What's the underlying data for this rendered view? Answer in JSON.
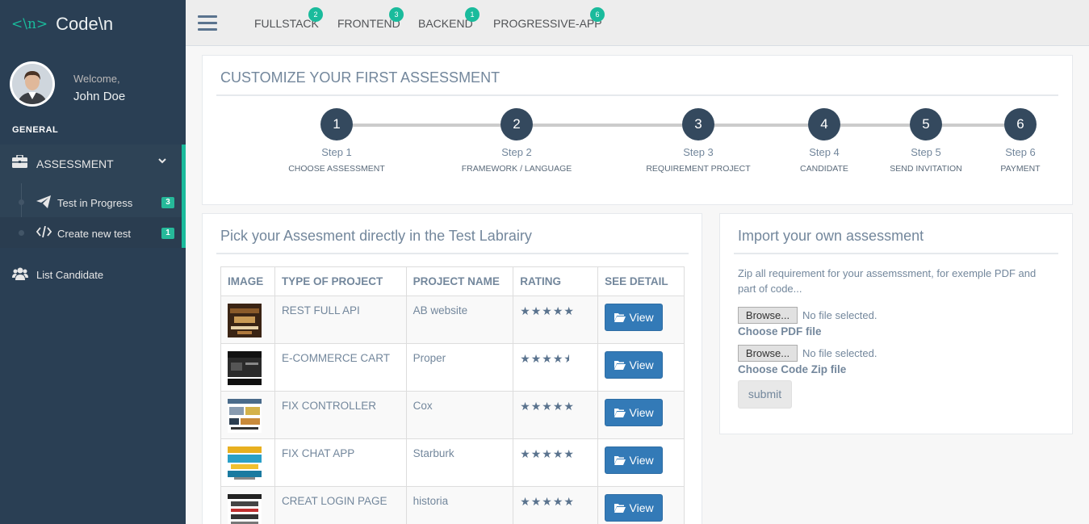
{
  "brand": {
    "logo": "<\\n>",
    "name": "Code\\n"
  },
  "profile": {
    "welcome": "Welcome,",
    "name": "John Doe"
  },
  "sidebar": {
    "section": "GENERAL",
    "assessment_label": "ASSESSMENT",
    "subitems": [
      {
        "label": "Test in Progress",
        "badge": "3"
      },
      {
        "label": "Create new test",
        "badge": "1"
      }
    ],
    "candidate_label": "List Candidate"
  },
  "topnav": {
    "items": [
      {
        "label": "FULLSTACK",
        "badge": "2"
      },
      {
        "label": "FRONTEND",
        "badge": "3"
      },
      {
        "label": "BACKEND",
        "badge": "1"
      },
      {
        "label": "PROGRESSIVE-APP",
        "badge": "6"
      }
    ]
  },
  "wizard": {
    "title": "CUSTOMIZE YOUR FIRST ASSESSMENT",
    "steps": [
      {
        "num": "1",
        "label": "Step 1",
        "desc": "CHOOSE ASSESSMENT"
      },
      {
        "num": "2",
        "label": "Step 2",
        "desc": "FRAMEWORK / LANGUAGE"
      },
      {
        "num": "3",
        "label": "Step 3",
        "desc": "REQUIREMENT PROJECT"
      },
      {
        "num": "4",
        "label": "Step 4",
        "desc": "CANDIDATE"
      },
      {
        "num": "5",
        "label": "Step 5",
        "desc": "SEND INVITATION"
      },
      {
        "num": "6",
        "label": "Step 6",
        "desc": "PAYMENT"
      }
    ]
  },
  "library": {
    "title": "Pick your Assesment directly in the Test Labrairy",
    "headers": [
      "IMAGE",
      "TYPE OF PROJECT",
      "PROJECT NAME",
      "RATING",
      "SEE DETAIL"
    ],
    "view_label": "View",
    "rows": [
      {
        "type": "REST FULL API",
        "name": "AB website",
        "rating": 5
      },
      {
        "type": "E-COMMERCE CART",
        "name": "Proper",
        "rating": 4.5
      },
      {
        "type": "FIX CONTROLLER",
        "name": "Cox",
        "rating": 5
      },
      {
        "type": "FIX CHAT APP",
        "name": "Starburk",
        "rating": 5
      },
      {
        "type": "CREAT LOGIN PAGE",
        "name": "historia",
        "rating": 5
      }
    ]
  },
  "import": {
    "title": "Import your own assessment",
    "description": "Zip all requirement for your assemssment, for exemple PDF and part of code...",
    "browse_label": "Browse...",
    "file_status": "No file selected.",
    "pdf_label": "Choose PDF file",
    "zip_label": "Choose Code Zip file",
    "submit_label": "submit"
  },
  "colors": {
    "sidebar": "#2A3F54",
    "accent": "#1ABB9C",
    "primary_button": "#337AB7"
  }
}
